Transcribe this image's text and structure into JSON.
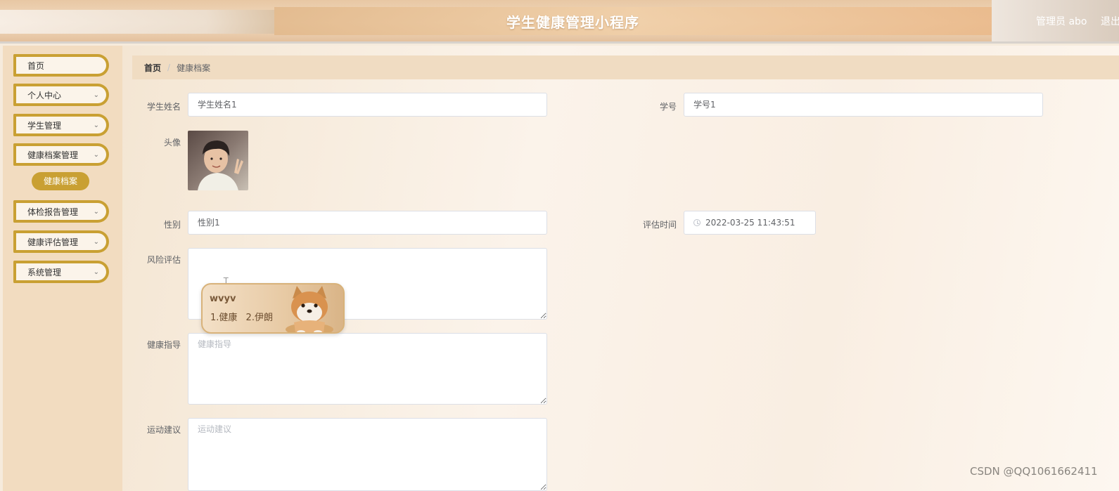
{
  "header": {
    "title": "学生健康管理小程序",
    "admin_label": "管理员 abo",
    "logout_label": "退出"
  },
  "sidebar": {
    "items": [
      {
        "label": "首页",
        "has_chevron": false
      },
      {
        "label": "个人中心",
        "has_chevron": true
      },
      {
        "label": "学生管理",
        "has_chevron": true
      },
      {
        "label": "健康档案管理",
        "has_chevron": true
      },
      {
        "label": "体检报告管理",
        "has_chevron": true
      },
      {
        "label": "健康评估管理",
        "has_chevron": true
      },
      {
        "label": "系统管理",
        "has_chevron": true
      }
    ],
    "active_sub_item": "健康档案",
    "chevron_icon": "chevron-down-icon"
  },
  "breadcrumb": {
    "home": "首页",
    "separator": "/",
    "current": "健康档案"
  },
  "form": {
    "student_name": {
      "label": "学生姓名",
      "value": "学生姓名1"
    },
    "student_id": {
      "label": "学号",
      "value": "学号1"
    },
    "avatar": {
      "label": "头像"
    },
    "gender": {
      "label": "性别",
      "value": "性别1"
    },
    "eval_time": {
      "label": "评估时间",
      "value": "2022-03-25 11:43:51"
    },
    "risk_assessment": {
      "label": "风险评估",
      "value": ""
    },
    "health_guidance": {
      "label": "健康指导",
      "placeholder": "健康指导"
    },
    "exercise_advice": {
      "label": "运动建议",
      "placeholder": "运动建议"
    }
  },
  "ime": {
    "input": "wvyv",
    "candidates": [
      "1.健康",
      "2.伊朗"
    ]
  },
  "watermark": "CSDN @QQ1061662411",
  "colors": {
    "accent_gold": "#c9a033",
    "sidebar_bg": "#f2dcc0",
    "breadcrumb_bg": "#f0dcc2"
  }
}
